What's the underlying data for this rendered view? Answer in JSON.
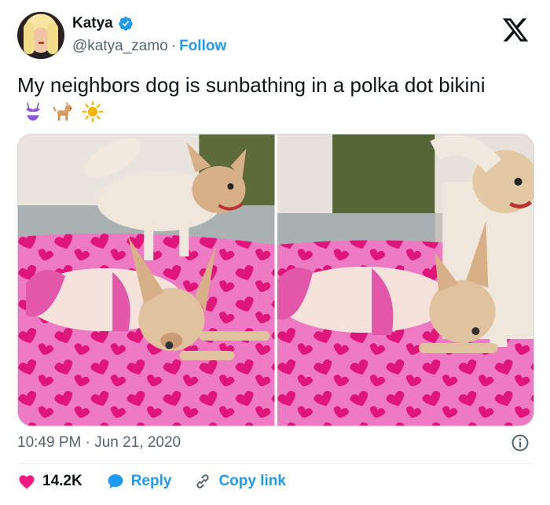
{
  "author": {
    "name": "Katya",
    "handle": "@katya_zamo",
    "separator": "·",
    "follow_label": "Follow",
    "verified": true
  },
  "tweet": {
    "text": "My neighbors dog is sunbathing in a polka dot bikini",
    "emojis": [
      "bikini-emoji",
      "dog-emoji",
      "sun-emoji"
    ],
    "timestamp": "10:49 PM · Jun 21, 2020"
  },
  "media": {
    "photos": [
      {
        "name": "chihuahua-photo-left"
      },
      {
        "name": "chihuahua-photo-right"
      }
    ]
  },
  "actions": {
    "likes": "14.2K",
    "reply_label": "Reply",
    "copy_link_label": "Copy link"
  },
  "colors": {
    "accent": "#1d9bf0",
    "like": "#f91880",
    "text_secondary": "#536471",
    "blanket": "#e86ab8",
    "hearts": "#e0157a"
  }
}
